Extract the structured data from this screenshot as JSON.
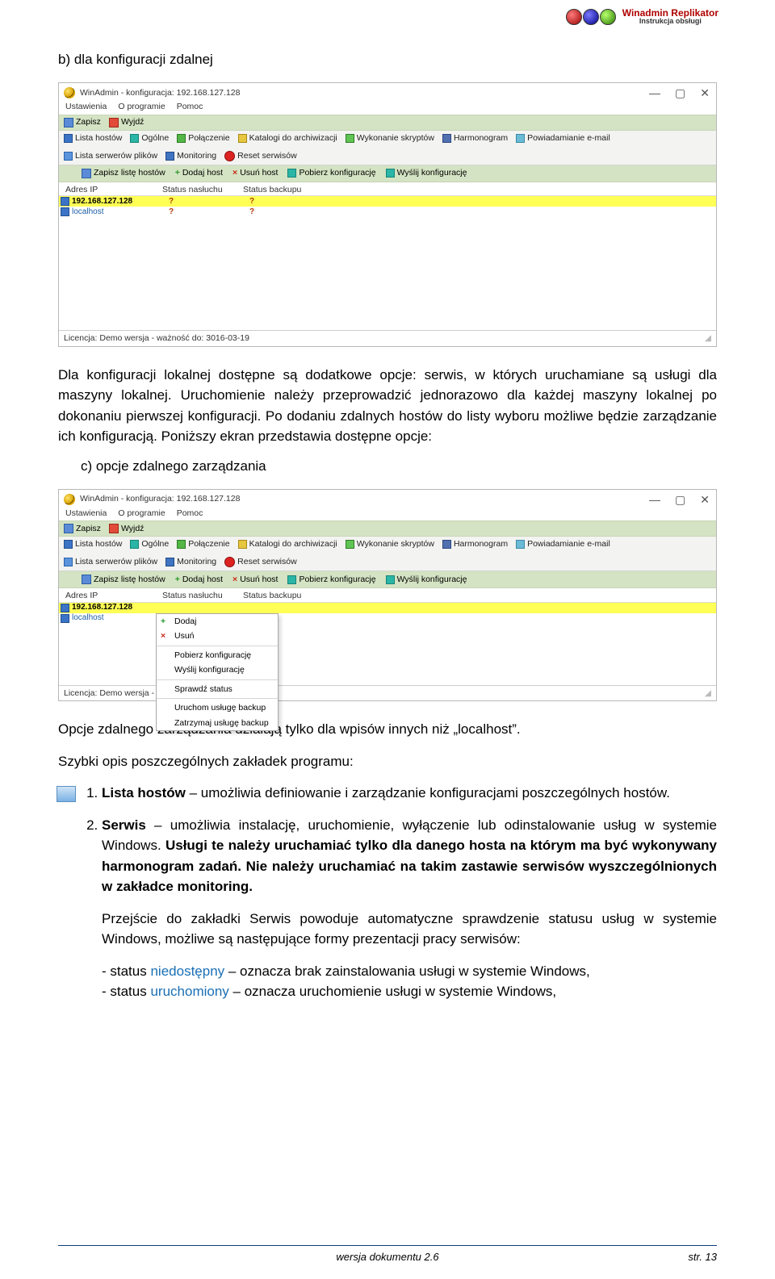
{
  "header": {
    "title": "Winadmin Replikator",
    "subtitle": "Instrukcja obsługi"
  },
  "sections": {
    "b_line": "b)   dla konfiguracji zdalnej",
    "c_line": "c)   opcje zdalnego zarządzania"
  },
  "paragraphs": {
    "p1": "Dla konfiguracji lokalnej dostępne są dodatkowe opcje: serwis, w których uruchamiane są usługi dla maszyny lokalnej. Uruchomienie należy przeprowadzić jednorazowo dla każdej maszyny lokalnej po dokonaniu pierwszej konfiguracji. Po dodaniu zdalnych hostów do listy wyboru możliwe będzie zarządzanie ich konfiguracją. Poniższy ekran przedstawia dostępne opcje:",
    "p2": "Opcje zdalnego zarządzania działają tylko dla wpisów innych niż „localhost”.",
    "p3": "Szybki opis poszczególnych zakładek programu:",
    "li1_label": "Lista hostów",
    "li1_rest": " – umożliwia definiowanie i zarządzanie konfiguracjami poszczególnych hostów.",
    "li2_label": "Serwis",
    "li2_rest_a": " – umożliwia instalację, uruchomienie, wyłączenie lub odinstalowanie usług w systemie Windows. ",
    "li2_bold": "Usługi te należy uruchamiać tylko dla danego hosta na którym ma być wykonywany harmonogram zadań. Nie należy uruchamiać na takim zastawie serwisów wyszczególnionych w zakładce monitoring.",
    "p_trans": "Przejście do zakładki Serwis powoduje automatyczne sprawdzenie statusu usług w systemie Windows, możliwe są następujące formy prezentacji pracy serwisów:",
    "bul1_a": "- status ",
    "bul1_b": "niedostępny",
    "bul1_c": " – oznacza brak zainstalowania usługi w systemie Windows,",
    "bul2_a": "- status ",
    "bul2_b": "uruchomiony",
    "bul2_c": " – oznacza uruchomienie usługi w systemie Windows,"
  },
  "app": {
    "title": "WinAdmin - konfiguracja: 192.168.127.128",
    "menu": [
      "Ustawienia",
      "O programie",
      "Pomoc"
    ],
    "save": "Zapisz",
    "exit": "Wyjdź",
    "tabs": [
      "Lista hostów",
      "Ogólne",
      "Połączenie",
      "Katalogi do archiwizacji",
      "Wykonanie skryptów",
      "Harmonogram",
      "Powiadamianie e-mail",
      "Lista serwerów plików",
      "Monitoring",
      "Reset serwisów"
    ],
    "hosts_tb": [
      "Zapisz listę hostów",
      "Dodaj host",
      "Usuń host",
      "Pobierz konfigurację",
      "Wyślij konfigurację"
    ],
    "cols": {
      "ip": "Adres IP",
      "s1": "Status nasłuchu",
      "s2": "Status backupu"
    },
    "rows": [
      {
        "ip": "192.168.127.128",
        "s1": "?",
        "s2": "?"
      },
      {
        "ip": "localhost",
        "s1": "?",
        "s2": "?"
      }
    ],
    "status": "Licencja: Demo wersja - ważność do: 3016-03-19",
    "context_menu": [
      "Dodaj",
      "Usuń",
      "Pobierz konfigurację",
      "Wyślij konfigurację",
      "Sprawdź status",
      "Uruchom usługę backup",
      "Zatrzymaj usługę backup"
    ]
  },
  "footer": {
    "center": "wersja dokumentu 2.6",
    "right": "str. 13"
  }
}
